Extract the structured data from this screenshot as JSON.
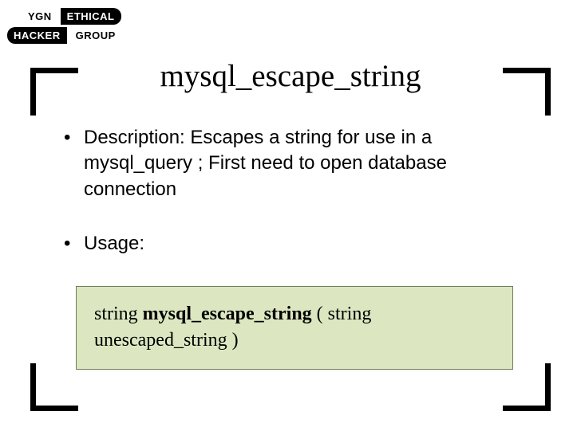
{
  "logo": {
    "top_left": "YGN",
    "top_right": "ETHICAL",
    "bottom_left": "HACKER",
    "bottom_right": "GROUP"
  },
  "title": "mysql_escape_string",
  "bullets": [
    "Description: Escapes a string for use in a mysql_query ; First need to open database connection",
    "Usage:"
  ],
  "code": {
    "prefix": "string ",
    "function": "mysql_escape_string",
    "suffix": " ( string unescaped_string )"
  }
}
